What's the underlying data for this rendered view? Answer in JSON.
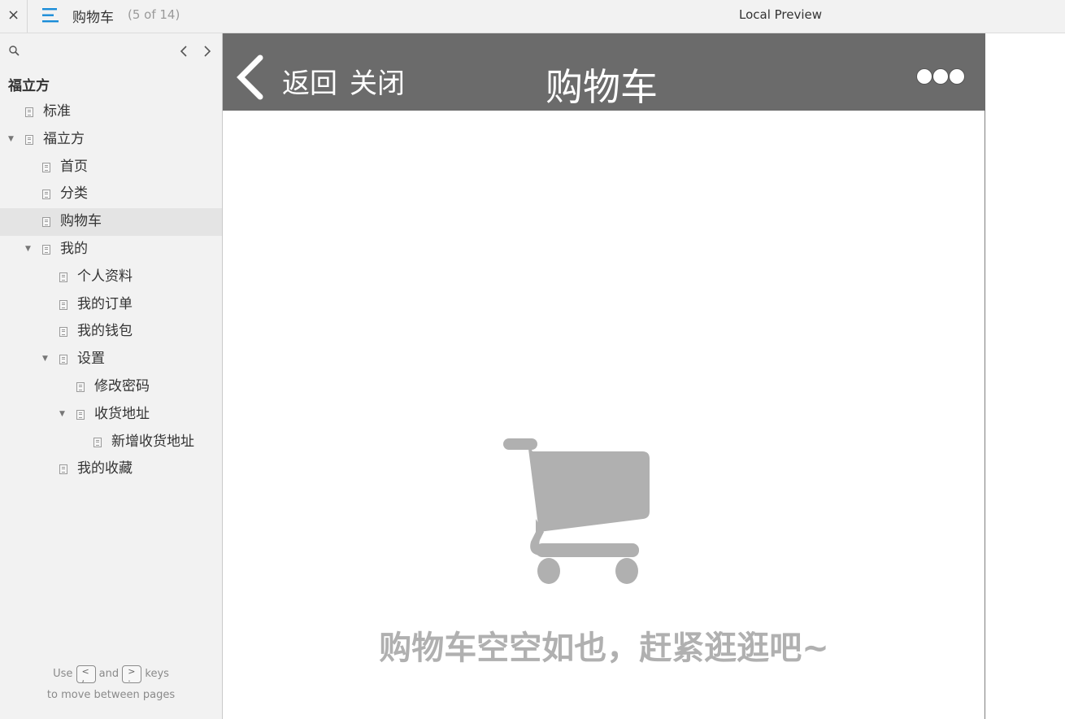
{
  "toolbar": {
    "close_symbol": "×",
    "page_title": "购物车",
    "page_count": "(5 of 14)",
    "preview_label": "Local Preview"
  },
  "sidebar": {
    "root_label": "福立方",
    "items": [
      {
        "label": "标准",
        "expanded": null
      },
      {
        "label": "福立方",
        "expanded": true
      },
      {
        "label": "首页",
        "expanded": null
      },
      {
        "label": "分类",
        "expanded": null
      },
      {
        "label": "购物车",
        "expanded": null,
        "selected": true
      },
      {
        "label": "我的",
        "expanded": true
      },
      {
        "label": "个人资料",
        "expanded": null
      },
      {
        "label": "我的订单",
        "expanded": null
      },
      {
        "label": "我的钱包",
        "expanded": null
      },
      {
        "label": "设置",
        "expanded": true
      },
      {
        "label": "修改密码",
        "expanded": null
      },
      {
        "label": "收货地址",
        "expanded": true
      },
      {
        "label": "新增收货地址",
        "expanded": null
      },
      {
        "label": "我的收藏",
        "expanded": null
      }
    ],
    "hint": {
      "use": "Use",
      "prev_key": "<\n,",
      "and": "and",
      "next_key": ">\n.",
      "keys": "keys",
      "line2": "to move between pages"
    }
  },
  "app": {
    "back_label": "返回",
    "close_label": "关闭",
    "title": "购物车",
    "empty_message": "购物车空空如也，赶紧逛逛吧~"
  },
  "colors": {
    "accent": "#1a8cd8",
    "header_bg": "#6b6b6b",
    "sidebar_bg": "#f2f2f2",
    "selected_bg": "#e4e4e4",
    "empty_gray": "#b0b0b0"
  },
  "icons": [
    "close-icon",
    "menu-icon",
    "search-icon",
    "chevron-left-icon",
    "chevron-right-icon",
    "document-icon",
    "back-arrow-icon",
    "more-dots-icon",
    "shopping-cart-icon"
  ]
}
